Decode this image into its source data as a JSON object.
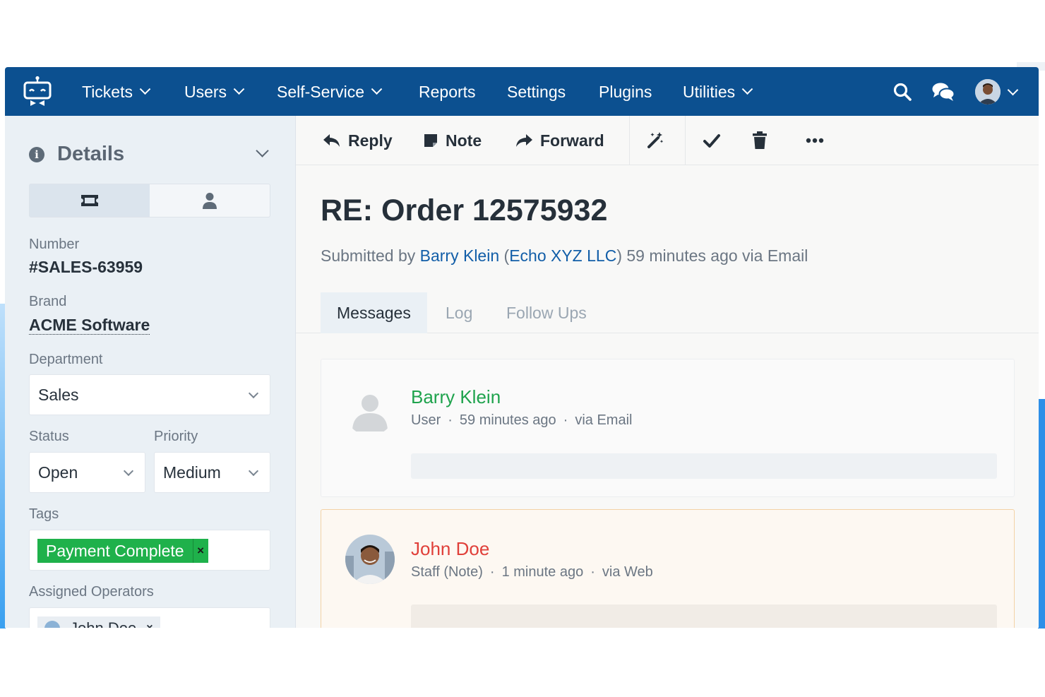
{
  "nav": {
    "items": [
      {
        "label": "Tickets",
        "dropdown": true
      },
      {
        "label": "Users",
        "dropdown": true
      },
      {
        "label": "Self-Service",
        "dropdown": true
      },
      {
        "label": "Reports",
        "dropdown": false
      },
      {
        "label": "Settings",
        "dropdown": false
      },
      {
        "label": "Plugins",
        "dropdown": false
      },
      {
        "label": "Utilities",
        "dropdown": true
      }
    ],
    "icons": [
      "search-icon",
      "chat-icon"
    ],
    "accent": "#0c5090"
  },
  "sidebar": {
    "title": "Details",
    "seg_icons": [
      "ticket-icon",
      "user-icon"
    ],
    "number_label": "Number",
    "number_value": "#SALES-63959",
    "brand_label": "Brand",
    "brand_value": "ACME Software",
    "department_label": "Department",
    "department_value": "Sales",
    "status_label": "Status",
    "status_value": "Open",
    "priority_label": "Priority",
    "priority_value": "Medium",
    "tags_label": "Tags",
    "tag": "Payment Complete",
    "tag_color": "#1fb14b",
    "operators_label": "Assigned Operators",
    "operator": "John Doe"
  },
  "toolbar": {
    "reply": "Reply",
    "note": "Note",
    "forward": "Forward",
    "icons": [
      "magic-wand-icon",
      "check-icon",
      "trash-icon",
      "more-icon"
    ]
  },
  "ticket": {
    "title": "RE: Order 12575932",
    "submitted_prefix": "Submitted by",
    "submitter": "Barry Klein",
    "org_open": "(",
    "organisation": "Echo XYZ LLC",
    "org_close": ")",
    "submitted_suffix": "59 minutes ago via Email"
  },
  "tabs": {
    "messages": "Messages",
    "log": "Log",
    "followups": "Follow Ups"
  },
  "messages": [
    {
      "name": "Barry Klein",
      "role": "User",
      "time": "59 minutes ago",
      "via": "via Email",
      "name_color": "#1fa34d"
    },
    {
      "name": "John Doe",
      "role": "Staff (Note)",
      "time": "1 minute ago",
      "via": "via Web",
      "name_color": "#e0403a"
    }
  ]
}
